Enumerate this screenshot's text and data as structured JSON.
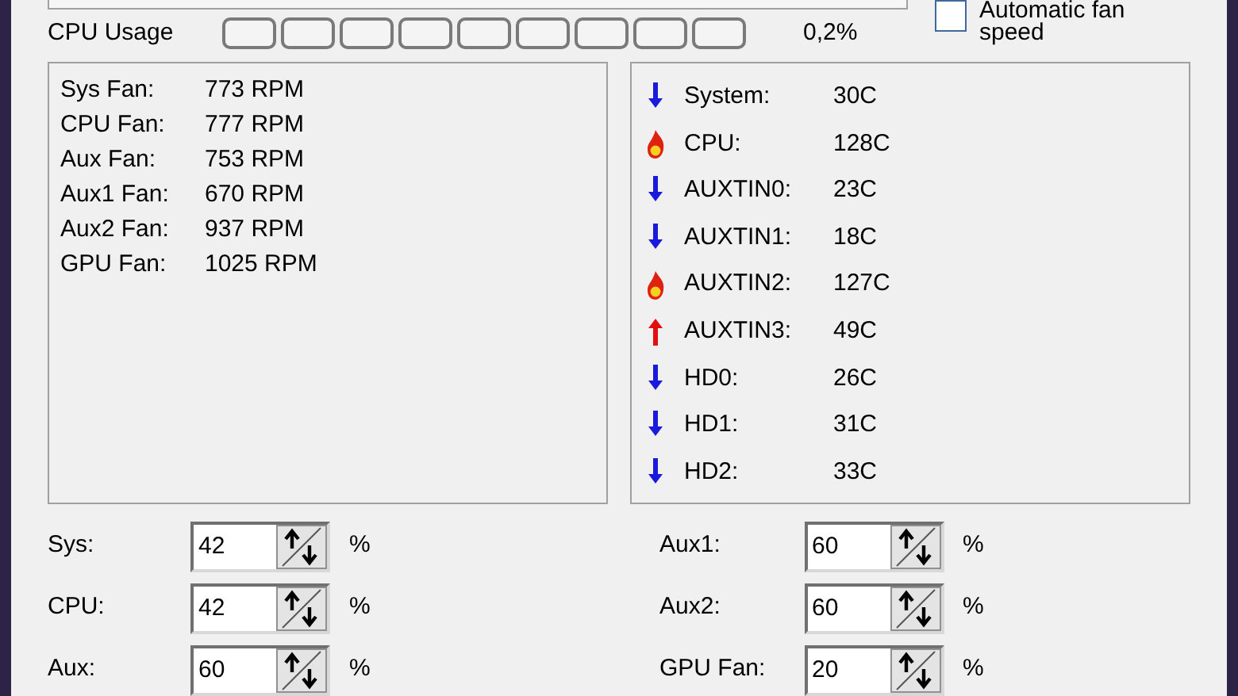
{
  "cpu_usage": {
    "label": "CPU Usage",
    "reading": "0,2%"
  },
  "auto_fan": {
    "label_lines": [
      "Automatic fan",
      "speed"
    ],
    "checked": false
  },
  "fans": [
    {
      "name": "Sys Fan:",
      "speed": "773 RPM"
    },
    {
      "name": "CPU Fan:",
      "speed": "777 RPM"
    },
    {
      "name": "Aux Fan:",
      "speed": "753 RPM"
    },
    {
      "name": "Aux1 Fan:",
      "speed": "670 RPM"
    },
    {
      "name": "Aux2 Fan:",
      "speed": "937 RPM"
    },
    {
      "name": "GPU Fan:",
      "speed": "1025 RPM"
    }
  ],
  "temperatures": [
    {
      "kind": "down",
      "name": "System:",
      "value": "30C"
    },
    {
      "kind": "fire",
      "name": "CPU:",
      "value": "128C"
    },
    {
      "kind": "down",
      "name": "AUXTIN0:",
      "value": "23C"
    },
    {
      "kind": "down",
      "name": "AUXTIN1:",
      "value": "18C"
    },
    {
      "kind": "fire",
      "name": "AUXTIN2:",
      "value": "127C"
    },
    {
      "kind": "up",
      "name": "AUXTIN3:",
      "value": "49C"
    },
    {
      "kind": "down",
      "name": "HD0:",
      "value": "26C"
    },
    {
      "kind": "down",
      "name": "HD1:",
      "value": "31C"
    },
    {
      "kind": "down",
      "name": "HD2:",
      "value": "33C"
    }
  ],
  "speed_settings": [
    {
      "label": "Sys:",
      "value": "42",
      "unit": "%"
    },
    {
      "label": "Aux1:",
      "value": "60",
      "unit": "%"
    },
    {
      "label": "CPU:",
      "value": "42",
      "unit": "%"
    },
    {
      "label": "Aux2:",
      "value": "60",
      "unit": "%"
    },
    {
      "label": "Aux:",
      "value": "60",
      "unit": "%"
    },
    {
      "label": "GPU Fan:",
      "value": "20",
      "unit": "%"
    }
  ]
}
